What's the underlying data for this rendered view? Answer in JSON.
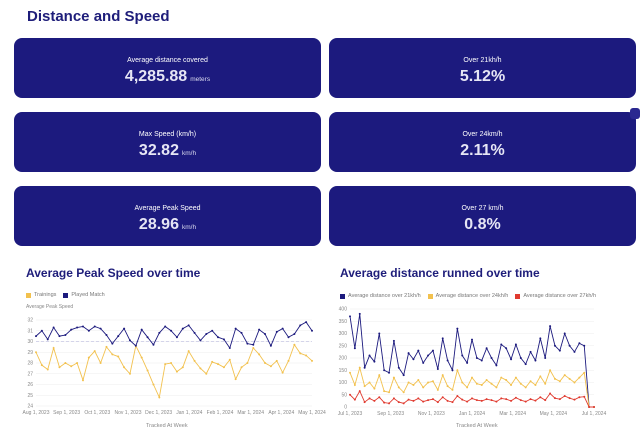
{
  "page_title": "Distance and Speed",
  "cards": [
    {
      "label": "Average distance covered",
      "value": "4,285.88",
      "unit": "meters"
    },
    {
      "label": "Max Speed (km/h)",
      "value": "32.82",
      "unit": "km/h"
    },
    {
      "label": "Average Peak Speed",
      "value": "28.96",
      "unit": "km/h"
    },
    {
      "label": "Over 21kh/h",
      "value": "5.12%",
      "unit": ""
    },
    {
      "label": "Over 24km/h",
      "value": "2.11%",
      "unit": ""
    },
    {
      "label": "Over 27 km/h",
      "value": "0.8%",
      "unit": ""
    }
  ],
  "colors": {
    "card_bg": "#1c1a7e",
    "navy": "#1c1a7e",
    "yellow": "#f2c14e",
    "red": "#e03a2f"
  },
  "chart_data": [
    {
      "type": "line",
      "title": "Average Peak Speed over time",
      "ylabel": "Average Peak Speed",
      "xlabel": "Tracked At Week",
      "ylim": [
        24,
        32
      ],
      "yticks": [
        24,
        25,
        26,
        27,
        28,
        29,
        30,
        31,
        32
      ],
      "xtick_labels": [
        "Aug 1, 2023",
        "Sep 1, 2023",
        "Oct 1, 2023",
        "Nov 1, 2023",
        "Dec 1, 2023",
        "Jan 1, 2024",
        "Feb 1, 2024",
        "Mar 1, 2024",
        "Apr 1, 2024",
        "May 1, 2024"
      ],
      "reference_line": 30,
      "series": [
        {
          "name": "Trainings",
          "color": "#f2c14e",
          "values": [
            29.0,
            27.8,
            27.4,
            29.4,
            27.6,
            28.0,
            27.7,
            28.0,
            26.4,
            28.5,
            29.1,
            28.0,
            29.5,
            28.8,
            28.6,
            27.6,
            27.0,
            29.6,
            28.5,
            27.3,
            26.0,
            24.8,
            27.9,
            28.0,
            27.2,
            27.6,
            29.1,
            28.2,
            27.5,
            27.0,
            28.1,
            27.9,
            27.6,
            28.3,
            26.5,
            27.6,
            28.0,
            29.4,
            28.8,
            28.0,
            27.7,
            28.2,
            27.1,
            28.2,
            29.7,
            28.9,
            28.7,
            28.2
          ]
        },
        {
          "name": "Played Match",
          "color": "#1c1a7e",
          "values": [
            30.5,
            31.0,
            30.2,
            31.3,
            30.5,
            30.6,
            31.1,
            31.3,
            31.4,
            31.0,
            31.4,
            31.2,
            30.6,
            29.8,
            30.5,
            31.2,
            30.1,
            29.6,
            31.1,
            30.4,
            29.7,
            30.8,
            31.4,
            31.0,
            30.4,
            31.2,
            31.5,
            30.8,
            30.1,
            30.7,
            31.0,
            30.4,
            30.2,
            29.4,
            31.2,
            30.8,
            29.8,
            29.7,
            31.1,
            30.7,
            29.6,
            30.9,
            31.2,
            30.4,
            30.7,
            31.5,
            31.8,
            31.0
          ]
        }
      ]
    },
    {
      "type": "line",
      "title": "Average distance runned over time",
      "xlabel": "Tracked At Week",
      "ylim": [
        0,
        400
      ],
      "yticks": [
        0,
        50,
        100,
        150,
        200,
        250,
        300,
        350,
        400
      ],
      "xtick_labels": [
        "Jul 1, 2023",
        "Sep 1, 2023",
        "Nov 1, 2023",
        "Jan 1, 2024",
        "Mar 1, 2024",
        "May 1, 2024",
        "Jul 1, 2024"
      ],
      "series": [
        {
          "name": "Average distance over 21kh/h",
          "color": "#1c1a7e",
          "values": [
            370,
            240,
            380,
            160,
            210,
            185,
            300,
            150,
            140,
            270,
            160,
            130,
            220,
            195,
            230,
            180,
            210,
            230,
            155,
            280,
            190,
            150,
            320,
            210,
            180,
            275,
            200,
            190,
            240,
            200,
            170,
            255,
            240,
            195,
            255,
            200,
            175,
            225,
            190,
            280,
            200,
            330,
            250,
            230,
            300,
            250,
            225,
            260,
            250,
            0,
            0
          ]
        },
        {
          "name": "Average distance over 24kh/h",
          "color": "#f2c14e",
          "values": [
            140,
            90,
            160,
            85,
            100,
            75,
            130,
            65,
            60,
            120,
            80,
            60,
            100,
            90,
            110,
            80,
            100,
            105,
            70,
            130,
            85,
            70,
            150,
            100,
            80,
            120,
            95,
            90,
            110,
            95,
            80,
            120,
            110,
            90,
            120,
            95,
            80,
            105,
            90,
            125,
            95,
            150,
            115,
            105,
            130,
            115,
            100,
            120,
            140,
            0,
            0
          ]
        },
        {
          "name": "Average distance over 27kh/h",
          "color": "#e03a2f",
          "values": [
            50,
            30,
            65,
            20,
            35,
            25,
            40,
            18,
            15,
            35,
            20,
            15,
            30,
            25,
            35,
            22,
            28,
            32,
            20,
            40,
            25,
            20,
            45,
            30,
            22,
            35,
            28,
            25,
            32,
            28,
            22,
            35,
            32,
            25,
            38,
            28,
            22,
            32,
            26,
            40,
            28,
            55,
            36,
            32,
            45,
            36,
            30,
            40,
            42,
            0,
            0
          ]
        }
      ]
    }
  ],
  "legend1": [
    "Trainings",
    "Played Match"
  ],
  "legend2": [
    "Average distance over 21kh/h",
    "Average distance over 24kh/h",
    "Average distance over 27kh/h"
  ]
}
